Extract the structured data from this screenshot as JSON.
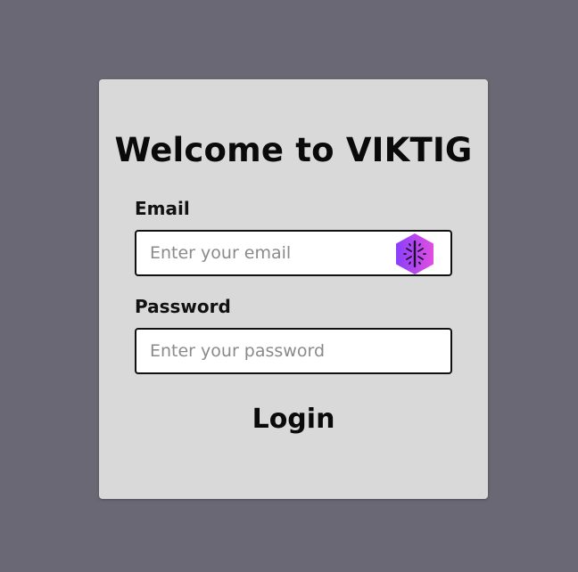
{
  "page": {
    "background_color": "#6b6875",
    "card_color": "#d9d9d9"
  },
  "form": {
    "title": "Welcome to VIKTIG",
    "email": {
      "label": "Email",
      "placeholder": "Enter your email",
      "value": ""
    },
    "password": {
      "label": "Password",
      "placeholder": "Enter your password",
      "value": ""
    },
    "login_label": "Login"
  },
  "extension_icon": {
    "name": "assistant-sparkle-icon",
    "gradient": [
      "#8a3ffc",
      "#e04fe0"
    ]
  }
}
